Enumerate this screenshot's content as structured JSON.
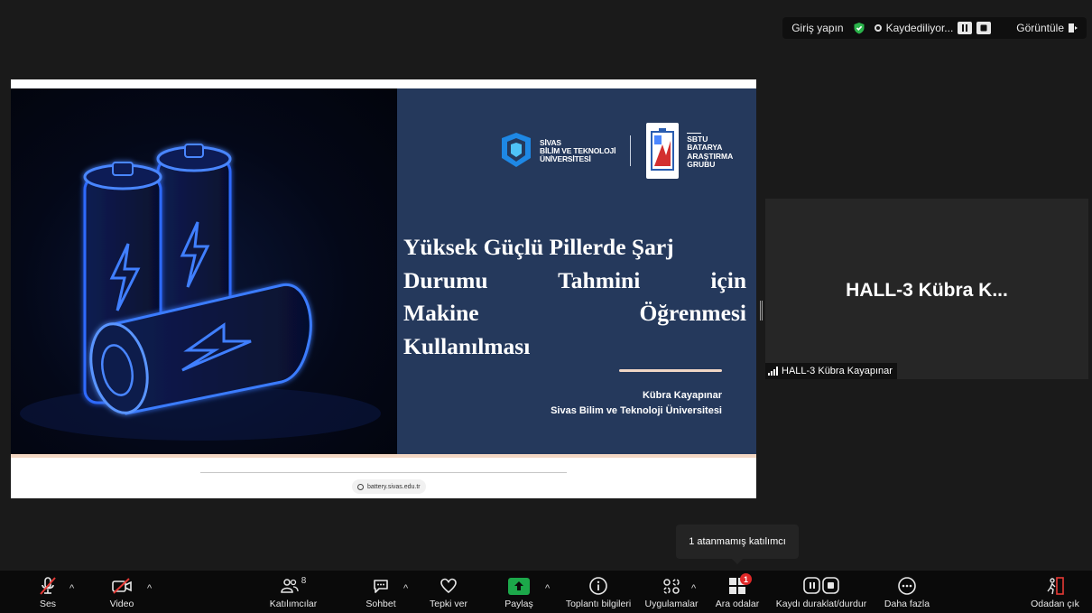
{
  "top_bar": {
    "sign_in": "Giriş yapın",
    "recording": "Kaydediliyor...",
    "view": "Görüntüle"
  },
  "slide": {
    "university": [
      "SİVAS",
      "BİLİM VE TEKNOLOJİ",
      "ÜNİVERSİTESİ"
    ],
    "group": [
      "SBTU",
      "BATARYA",
      "ARAŞTIRMA",
      "GRUBU"
    ],
    "title_lines": [
      "Yüksek Güçlü Pillerde Şarj",
      "Durumu Tahmini için",
      "Makine Öğrenmesi",
      "Kullanılması"
    ],
    "author": "Kübra Kayapınar",
    "affiliation": "Sivas Bilim ve Teknoloji Üniversitesi",
    "url": "battery.sivas.edu.tr"
  },
  "participant": {
    "display_name": "HALL-3 Kübra K...",
    "label": "HALL-3 Kübra Kayapınar"
  },
  "tooltip": "1 atanmamış katılımcı",
  "toolbar": {
    "audio": "Ses",
    "video": "Video",
    "participants": "Katılımcılar",
    "participants_count": "8",
    "chat": "Sohbet",
    "react": "Tepki ver",
    "share": "Paylaş",
    "meeting_info": "Toplantı bilgileri",
    "apps": "Uygulamalar",
    "breakout": "Ara odalar",
    "breakout_badge": "1",
    "recording_control": "Kaydı duraklat/durdur",
    "more": "Daha fazla",
    "leave": "Odadan çık"
  },
  "colors": {
    "slide_panel": "#25395c",
    "accent_peach": "#f0d6c5",
    "share_green": "#1ca84a",
    "badge_red": "#e02828",
    "shield_green": "#2bb44b"
  }
}
